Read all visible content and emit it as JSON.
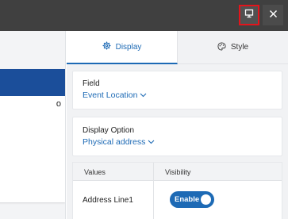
{
  "left_pane": {
    "text_fragment": "o"
  },
  "tabs": [
    {
      "label": "Display",
      "icon": "gear-icon",
      "active": true
    },
    {
      "label": "Style",
      "icon": "palette-icon",
      "active": false
    }
  ],
  "field": {
    "label": "Field",
    "value": "Event Location"
  },
  "display_option": {
    "label": "Display Option",
    "value": "Physical address"
  },
  "table": {
    "headers": [
      "Values",
      "Visibility"
    ],
    "rows": [
      {
        "value": "Address Line1",
        "visibility": "Enable"
      }
    ]
  },
  "colors": {
    "accent": "#1d6ab5",
    "topbar": "#404040",
    "highlight_border": "#e4141b"
  }
}
